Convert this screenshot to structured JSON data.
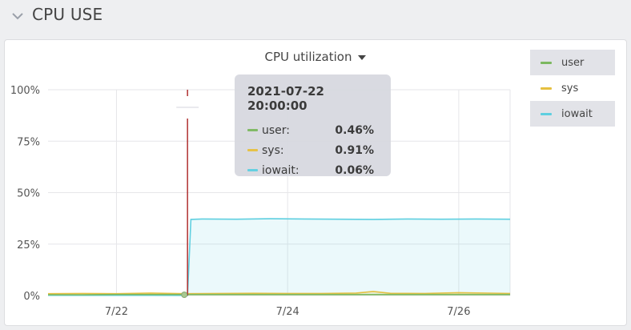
{
  "section": {
    "title": "CPU USE",
    "collapse_icon": "chevron-down-icon"
  },
  "panel": {
    "title": "CPU utilization",
    "menu_icon": "caret-down-icon"
  },
  "colors": {
    "user": "#7cb860",
    "sys": "#e6c040",
    "iowait": "#5ecfe0",
    "cursor_line": "#b03030"
  },
  "tooltip": {
    "timestamp": "2021-07-22 20:00:00",
    "rows": [
      {
        "name": "user:",
        "value": "0.46%",
        "color": "#7cb860"
      },
      {
        "name": "sys:",
        "value": "0.91%",
        "color": "#e6c040"
      },
      {
        "name": "iowait:",
        "value": "0.06%",
        "color": "#5ecfe0"
      }
    ]
  },
  "legend": [
    {
      "label": "user",
      "color": "#7cb860",
      "highlighted": true
    },
    {
      "label": "sys",
      "color": "#e6c040",
      "highlighted": false
    },
    {
      "label": "iowait",
      "color": "#5ecfe0",
      "highlighted": true
    }
  ],
  "chart_data": {
    "type": "area",
    "x_ticks": [
      "7/22",
      "7/24",
      "7/26"
    ],
    "y_ticks": [
      "0%",
      "25%",
      "50%",
      "75%",
      "100%"
    ],
    "ylim": [
      0,
      100
    ],
    "xlim_days": [
      21.2,
      26.6
    ],
    "x_tick_days": [
      22,
      24,
      26
    ],
    "cursor_day": 22.83,
    "grid": true,
    "legend_position": "right",
    "series": [
      {
        "name": "user",
        "days": [
          21.2,
          21.6,
          22.0,
          22.4,
          22.8,
          23.2,
          23.6,
          24.0,
          24.4,
          24.8,
          25.2,
          25.6,
          26.0,
          26.6
        ],
        "values": [
          0.4,
          0.4,
          0.5,
          0.5,
          0.5,
          0.5,
          0.5,
          0.5,
          0.5,
          0.5,
          0.5,
          0.5,
          0.5,
          0.5
        ]
      },
      {
        "name": "sys",
        "days": [
          21.2,
          21.6,
          22.0,
          22.4,
          22.8,
          23.2,
          23.6,
          24.0,
          24.4,
          24.8,
          25.0,
          25.2,
          25.6,
          26.0,
          26.6
        ],
        "values": [
          0.9,
          1.0,
          0.9,
          1.2,
          0.9,
          1.0,
          1.1,
          1.0,
          1.0,
          1.2,
          2.0,
          1.1,
          1.0,
          1.4,
          1.0
        ]
      },
      {
        "name": "iowait",
        "days": [
          21.2,
          21.6,
          22.0,
          22.4,
          22.83,
          22.87,
          23.0,
          23.4,
          23.8,
          24.2,
          24.6,
          25.0,
          25.4,
          25.8,
          26.2,
          26.6
        ],
        "values": [
          0.1,
          0.1,
          0.1,
          0.1,
          0.06,
          37,
          37.2,
          37.1,
          37.3,
          37.2,
          37.1,
          37.0,
          37.2,
          37.1,
          37.2,
          37.1
        ]
      }
    ]
  }
}
